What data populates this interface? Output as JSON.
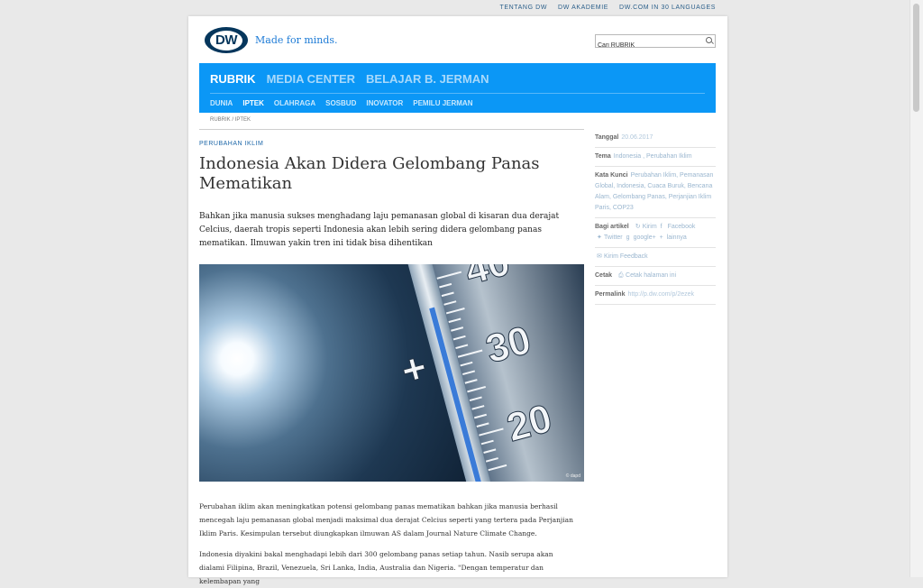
{
  "toplinks": [
    "TENTANG DW",
    "DW AKADEMIE",
    "DW.COM IN 30 LANGUAGES"
  ],
  "logo": {
    "text": "DW",
    "tagline": "Made for minds."
  },
  "search": {
    "value": "Cari RUBRIK"
  },
  "nav": {
    "main": [
      "RUBRIK",
      "MEDIA CENTER",
      "BELAJAR B. JERMAN"
    ],
    "sub": [
      "DUNIA",
      "IPTEK",
      "OLAHRAGA",
      "SOSBUD",
      "INOVATOR",
      "PEMILU JERMAN"
    ]
  },
  "breadcrumb": "RUBRIK / IPTEK",
  "article": {
    "kicker": "PERUBAHAN IKLIM",
    "title": "Indonesia Akan Didera Gelombang Panas Mematikan",
    "lead": "Bahkan jika manusia sukses menghadang laju pemanasan global di kisaran dua derajat Celcius, daerah tropis seperti Indonesia akan lebih sering didera gelombang panas mematikan. Ilmuwan yakin tren ini tidak bisa dihentikan",
    "image_credit": "© dapd",
    "thermo": {
      "plus": "+",
      "t40": "40",
      "t30": "30",
      "t20": "20"
    },
    "para1": "Perubahan iklim akan meningkatkan potensi gelombang panas mematikan bahkan jika manusia berhasil mencegah laju pemanasan global menjadi maksimal dua derajat Celcius seperti yang tertera pada Perjanjian Iklim Paris. Kesimpulan tersebut diungkapkan ilmuwan AS dalam Journal Nature Climate Change.",
    "para2": "Indonesia diyakini bakal menghadapi lebih dari 300 gelombang panas setiap tahun. Nasib serupa akan dialami Filipina, Brazil, Venezuela, Sri Lanka, India, Australia dan Nigeria. \"Dengan temperatur dan kelembapan yang"
  },
  "sidebar": {
    "tanggal_label": "Tanggal",
    "tanggal_value": "20.06.2017",
    "tema_label": "Tema",
    "tema_value": "Indonesia , Perubahan Iklim",
    "kata_label": "Kata Kunci",
    "kata_value": "Perubahan Iklim, Pemanasan Global, Indonesia, Cuaca Buruk, Bencana Alam, Gelombang Panas, Perjanjian Iklim Paris, COP23",
    "bagi_label": "Bagi artikel",
    "kirim": "Kirim",
    "facebook": "Facebook",
    "twitter": "Twitter",
    "google": "google+",
    "lainnya": "lainnya",
    "feedback": "Kirim Feedback",
    "cetak_label": "Cetak",
    "cetak_value": "Cetak halaman ini",
    "permalink_label": "Permalink",
    "permalink_value": "http://p.dw.com/p/2ezek"
  }
}
